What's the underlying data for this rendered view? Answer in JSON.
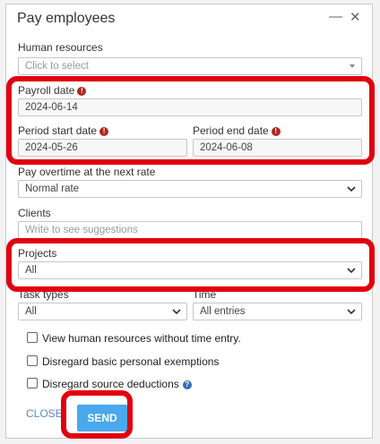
{
  "dialog": {
    "title": "Pay employees",
    "minimize_glyph": "—",
    "close_glyph": "✕"
  },
  "human_resources": {
    "label": "Human resources",
    "placeholder": "Click to select"
  },
  "payroll_date": {
    "label": "Payroll date",
    "value": "2024-06-14"
  },
  "period_start": {
    "label": "Period start date",
    "value": "2024-05-26"
  },
  "period_end": {
    "label": "Period end date",
    "value": "2024-06-08"
  },
  "overtime": {
    "label": "Pay overtime at the next rate",
    "value": "Normal rate"
  },
  "clients": {
    "label": "Clients",
    "placeholder": "Write to see suggestions"
  },
  "projects": {
    "label": "Projects",
    "value": "All"
  },
  "task_types": {
    "label": "Task types",
    "value": "All"
  },
  "time": {
    "label": "Time",
    "value": "All entries"
  },
  "checkboxes": [
    {
      "label": "View human resources without time entry."
    },
    {
      "label": "Disregard basic personal exemptions"
    },
    {
      "label": "Disregard source deductions"
    }
  ],
  "icons": {
    "required": "!",
    "help": "?"
  },
  "footer": {
    "close_label": "CLOSE",
    "send_label": "SEND"
  },
  "colors": {
    "highlight": "#e0000f",
    "send_button": "#4aa8ec",
    "required_icon": "#b3261e",
    "help_icon": "#2f6fb8"
  }
}
